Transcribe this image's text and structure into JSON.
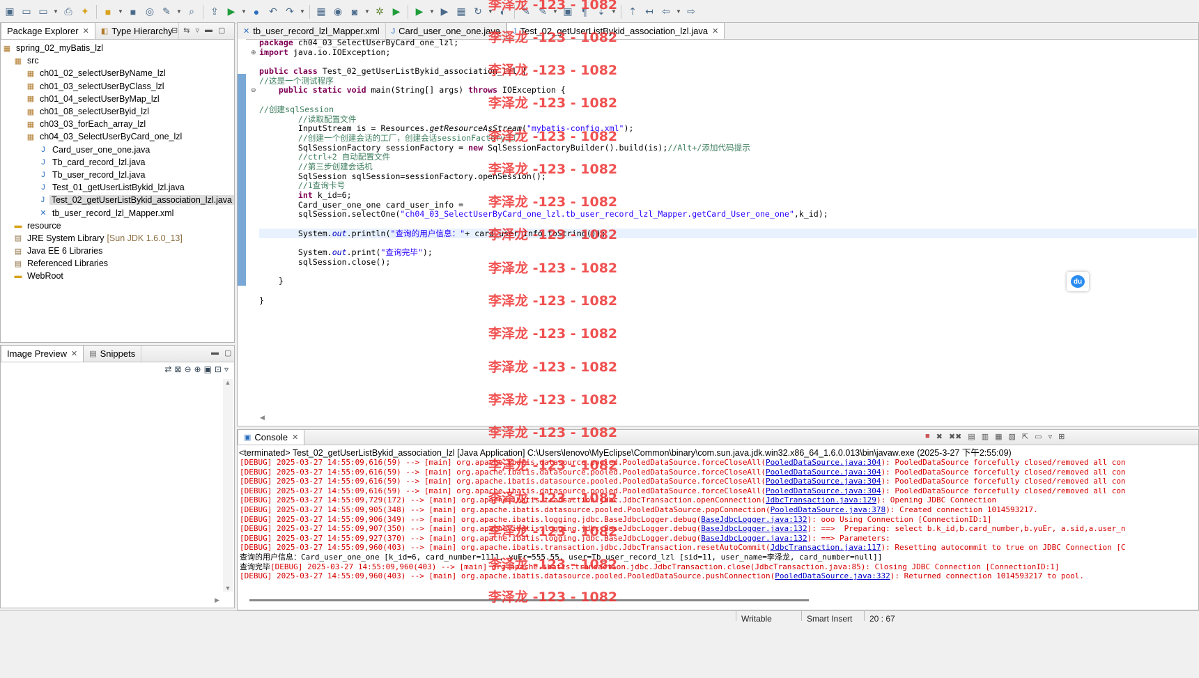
{
  "toolbar": {
    "icons": [
      "new-icon",
      "save-icon",
      "save-all-icon",
      "print-icon",
      "new-wizard-icon",
      "open-type-icon",
      "open-task-icon",
      "server-icon",
      "search-icon",
      "search-file-icon",
      "deploy-icon",
      "run-server-icon",
      "globe-icon",
      "prev-edit-icon",
      "next-edit-icon",
      "open-folder-icon",
      "server-stop-icon",
      "camera-icon",
      "debug-icon",
      "run-icon",
      "run-coverage-icon",
      "run-external-icon",
      "new-package-icon",
      "refresh-icon",
      "open-type-hierarchy-icon",
      "pin-icon",
      "mark-occurrences-icon",
      "block-select-icon",
      "show-whitespace-icon",
      "next-annotation-icon",
      "prev-annotation-icon",
      "last-edit-icon",
      "back-icon",
      "forward-icon"
    ],
    "colors": {
      "accent": "#2a6dbf",
      "run": "#1f9d3a",
      "debug": "#5b7f2a",
      "warn": "#d8a21c"
    }
  },
  "package_explorer": {
    "tabs": [
      {
        "label": "Package Explorer",
        "icon": "package-explorer-icon"
      },
      {
        "label": "Type Hierarchy",
        "icon": "type-hierarchy-icon"
      }
    ],
    "project": "spring_02_myBatis_lzl",
    "items": [
      {
        "label": "src",
        "icon": "source-folder-icon"
      },
      {
        "label": "ch01_02_selectUserByName_lzl",
        "icon": "package-icon"
      },
      {
        "label": "ch01_03_selectUserByClass_lzl",
        "icon": "package-icon"
      },
      {
        "label": "ch01_04_selectUserByMap_lzl",
        "icon": "package-icon"
      },
      {
        "label": "ch01_08_selectUserByid_lzl",
        "icon": "package-icon"
      },
      {
        "label": "ch03_03_forEach_array_lzl",
        "icon": "package-icon"
      },
      {
        "label": "ch04_03_SelectUserByCard_one_lzl",
        "icon": "package-icon"
      },
      {
        "label": "Card_user_one_one.java",
        "icon": "java-file-icon"
      },
      {
        "label": "Tb_card_record_lzl.java",
        "icon": "java-file-icon"
      },
      {
        "label": "Tb_user_record_lzl.java",
        "icon": "java-file-icon"
      },
      {
        "label": "Test_01_getUserListBykid_lzl.java",
        "icon": "java-file-icon"
      },
      {
        "label": "Test_02_getUserListBykid_association_lzl.java",
        "icon": "java-file-icon"
      },
      {
        "label": "tb_user_record_lzl_Mapper.xml",
        "icon": "xml-file-icon"
      },
      {
        "label": "resource",
        "icon": "folder-icon"
      },
      {
        "label": "JRE System Library",
        "icon": "library-icon",
        "suffix": "[Sun JDK 1.6.0_13]"
      },
      {
        "label": "Java EE 6 Libraries",
        "icon": "library-icon"
      },
      {
        "label": "Referenced Libraries",
        "icon": "library-icon"
      },
      {
        "label": "WebRoot",
        "icon": "folder-icon"
      }
    ]
  },
  "image_preview": {
    "tabs": [
      {
        "label": "Image Preview",
        "icon": "image-preview-icon"
      },
      {
        "label": "Snippets",
        "icon": "snippets-icon"
      }
    ]
  },
  "editor": {
    "tabs": [
      {
        "label": "tb_user_record_lzl_Mapper.xml",
        "icon": "xml-file-icon"
      },
      {
        "label": "Card_user_one_one.java",
        "icon": "java-file-icon"
      },
      {
        "label": "Test_02_getUserListBykid_association_lzl.java",
        "icon": "java-file-icon"
      }
    ],
    "lines": [
      {
        "parts": [
          {
            "c": "kw",
            "t": "package"
          },
          {
            "t": " ch04_03_SelectUserByCard_one_lzl;"
          }
        ]
      },
      {
        "parts": [
          {
            "c": "kw",
            "t": "import"
          },
          {
            "t": " java.io.IOException;"
          }
        ]
      },
      {
        "parts": []
      },
      {
        "parts": [
          {
            "c": "kw",
            "t": "public class"
          },
          {
            "t": " Test_02_getUserListBykid_association_lzl {"
          }
        ]
      },
      {
        "parts": [
          {
            "c": "cm",
            "t": "//这是一个测试程序"
          }
        ]
      },
      {
        "parts": [
          {
            "t": "    "
          },
          {
            "c": "kw",
            "t": "public static void"
          },
          {
            "t": " main(String[] args) "
          },
          {
            "c": "kw",
            "t": "throws"
          },
          {
            "t": " IOException {"
          }
        ]
      },
      {
        "parts": []
      },
      {
        "parts": [
          {
            "c": "cm",
            "t": "//创建sqlSession"
          }
        ]
      },
      {
        "parts": [
          {
            "t": "        "
          },
          {
            "c": "cm",
            "t": "//读取配置文件"
          }
        ]
      },
      {
        "parts": [
          {
            "t": "        InputStream is = Resources."
          },
          {
            "c": "it",
            "t": "getResourceAsStream"
          },
          {
            "t": "("
          },
          {
            "c": "st",
            "t": "\"mybatis-config.xml\""
          },
          {
            "t": ");"
          }
        ]
      },
      {
        "parts": [
          {
            "t": "        "
          },
          {
            "c": "cm",
            "t": "//创建一个创建会话的工厂，创建会话sessionFactory工厂"
          }
        ]
      },
      {
        "parts": [
          {
            "t": "        SqlSessionFactory sessionFactory = "
          },
          {
            "c": "kw",
            "t": "new"
          },
          {
            "t": " SqlSessionFactoryBuilder().build(is);"
          },
          {
            "c": "cm",
            "t": "//Alt+/添加代码提示"
          }
        ]
      },
      {
        "parts": [
          {
            "t": "        "
          },
          {
            "c": "cm",
            "t": "//ctrl+2 自动配置文件"
          }
        ]
      },
      {
        "parts": [
          {
            "t": "        "
          },
          {
            "c": "cm",
            "t": "//第三步创建会话机"
          }
        ]
      },
      {
        "parts": [
          {
            "t": "        SqlSession sqlSession=sessionFactory.openSession();"
          }
        ]
      },
      {
        "parts": [
          {
            "t": "        "
          },
          {
            "c": "cm",
            "t": "//1查询卡号"
          }
        ]
      },
      {
        "parts": [
          {
            "t": "        "
          },
          {
            "c": "kw",
            "t": "int"
          },
          {
            "t": " k_id=6;"
          }
        ]
      },
      {
        "parts": [
          {
            "t": "        Card_user_one_one card_user_info ="
          }
        ]
      },
      {
        "parts": [
          {
            "t": "        sqlSession.selectOne("
          },
          {
            "c": "st",
            "t": "\"ch04_03_SelectUserByCard_one_lzl.tb_user_record_lzl_Mapper.getCard_User_one_one\""
          },
          {
            "t": ",k_id);"
          }
        ]
      },
      {
        "parts": []
      },
      {
        "parts": [
          {
            "t": "        System."
          },
          {
            "c": "fl",
            "t": "out"
          },
          {
            "t": ".println("
          },
          {
            "c": "st",
            "t": "\"查询的用户信息：\""
          },
          {
            "t": "+ card_user_info.toString());"
          }
        ]
      },
      {
        "parts": []
      },
      {
        "parts": [
          {
            "t": "        System."
          },
          {
            "c": "fl",
            "t": "out"
          },
          {
            "t": ".print("
          },
          {
            "c": "st",
            "t": "\"查询完毕\""
          },
          {
            "t": ");"
          }
        ]
      },
      {
        "parts": [
          {
            "t": "        sqlSession.close();"
          }
        ]
      },
      {
        "parts": []
      },
      {
        "parts": [
          {
            "t": "    }"
          }
        ]
      },
      {
        "parts": []
      },
      {
        "parts": [
          {
            "t": "}"
          }
        ]
      }
    ]
  },
  "console": {
    "tab": {
      "label": "Console",
      "icon": "console-icon"
    },
    "title": "<terminated> Test_02_getUserListBykid_association_lzl [Java Application] C:\\Users\\lenovo\\MyEclipse\\Common\\binary\\com.sun.java.jdk.win32.x86_64_1.6.0.013\\bin\\javaw.exe (2025-3-27 下午2:55:09)",
    "lines": [
      {
        "parts": [
          {
            "t": "[DEBUG] 2025-03-27 14:55:09,616(59) --> [main] org.apache.ibatis.datasource.pooled.PooledDataSource.forceCloseAll("
          },
          {
            "c": "ln",
            "t": "PooledDataSource.java:304"
          },
          {
            "t": "): PooledDataSource forcefully closed/removed all con"
          }
        ]
      },
      {
        "parts": [
          {
            "t": "[DEBUG] 2025-03-27 14:55:09,616(59) --> [main] org.apache.ibatis.datasource.pooled.PooledDataSource.forceCloseAll("
          },
          {
            "c": "ln",
            "t": "PooledDataSource.java:304"
          },
          {
            "t": "): PooledDataSource forcefully closed/removed all con"
          }
        ]
      },
      {
        "parts": [
          {
            "t": "[DEBUG] 2025-03-27 14:55:09,616(59) --> [main] org.apache.ibatis.datasource.pooled.PooledDataSource.forceCloseAll("
          },
          {
            "c": "ln",
            "t": "PooledDataSource.java:304"
          },
          {
            "t": "): PooledDataSource forcefully closed/removed all con"
          }
        ]
      },
      {
        "parts": [
          {
            "t": "[DEBUG] 2025-03-27 14:55:09,616(59) --> [main] org.apache.ibatis.datasource.pooled.PooledDataSource.forceCloseAll("
          },
          {
            "c": "ln",
            "t": "PooledDataSource.java:304"
          },
          {
            "t": "): PooledDataSource forcefully closed/removed all con"
          }
        ]
      },
      {
        "parts": [
          {
            "t": "[DEBUG] 2025-03-27 14:55:09,729(172) --> [main] org.apache.ibatis.transaction.jdbc.JdbcTransaction.openConnection("
          },
          {
            "c": "ln",
            "t": "JdbcTransaction.java:129"
          },
          {
            "t": "): Opening JDBC Connection"
          }
        ]
      },
      {
        "parts": [
          {
            "t": "[DEBUG] 2025-03-27 14:55:09,905(348) --> [main] org.apache.ibatis.datasource.pooled.PooledDataSource.popConnection("
          },
          {
            "c": "ln",
            "t": "PooledDataSource.java:378"
          },
          {
            "t": "): Created connection 1014593217."
          }
        ]
      },
      {
        "parts": [
          {
            "t": "[DEBUG] 2025-03-27 14:55:09,906(349) --> [main] org.apache.ibatis.logging.jdbc.BaseJdbcLogger.debug("
          },
          {
            "c": "ln",
            "t": "BaseJdbcLogger.java:132"
          },
          {
            "t": "): ooo Using Connection [ConnectionID:1]"
          }
        ]
      },
      {
        "parts": [
          {
            "t": "[DEBUG] 2025-03-27 14:55:09,907(350) --> [main] org.apache.ibatis.logging.jdbc.BaseJdbcLogger.debug("
          },
          {
            "c": "ln",
            "t": "BaseJdbcLogger.java:132"
          },
          {
            "t": "): ==>  Preparing: select b.k_id,b.card_number,b.yuEr, a.sid,a.user_n"
          }
        ]
      },
      {
        "parts": [
          {
            "t": "[DEBUG] 2025-03-27 14:55:09,927(370) --> [main] org.apache.ibatis.logging.jdbc.BaseJdbcLogger.debug("
          },
          {
            "c": "ln",
            "t": "BaseJdbcLogger.java:132"
          },
          {
            "t": "): ==> Parameters:"
          }
        ]
      },
      {
        "parts": [
          {
            "t": "[DEBUG] 2025-03-27 14:55:09,960(403) --> [main] org.apache.ibatis.transaction.jdbc.JdbcTransaction.resetAutoCommit("
          },
          {
            "c": "ln",
            "t": "JdbcTransaction.java:117"
          },
          {
            "t": "): Resetting autocommit to true on JDBC Connection [C"
          }
        ]
      },
      {
        "parts": [
          {
            "c": "blk",
            "t": "查询的用户信息：Card_user_one_one [k_id=6, card_number=1111, yuEr=555.55, user=Tb_user_record_lzl [sid=11, user_name=李泽龙, card_number=null]]"
          }
        ]
      },
      {
        "parts": [
          {
            "c": "blk",
            "t": "查询完毕"
          },
          {
            "t": "[DEBUG] 2025-03-27 14:55:09,960(403) --> [main] org.apache.ibatis.transaction.jdbc.JdbcTransaction.close(JdbcTransaction.java:85): Closing JDBC Connection [ConnectionID:1]"
          }
        ]
      },
      {
        "parts": [
          {
            "t": "[DEBUG] 2025-03-27 14:55:09,960(403) --> [main] org.apache.ibatis.datasource.pooled.PooledDataSource.pushConnection("
          },
          {
            "c": "ln",
            "t": "PooledDataSource.java:332"
          },
          {
            "t": "): Returned connection 1014593217 to pool."
          }
        ]
      }
    ]
  },
  "watermark": "李泽龙 -123 - 1082",
  "status_bar": {
    "writable": "Writable",
    "insert_mode": "Smart Insert",
    "position": "20 : 67"
  }
}
